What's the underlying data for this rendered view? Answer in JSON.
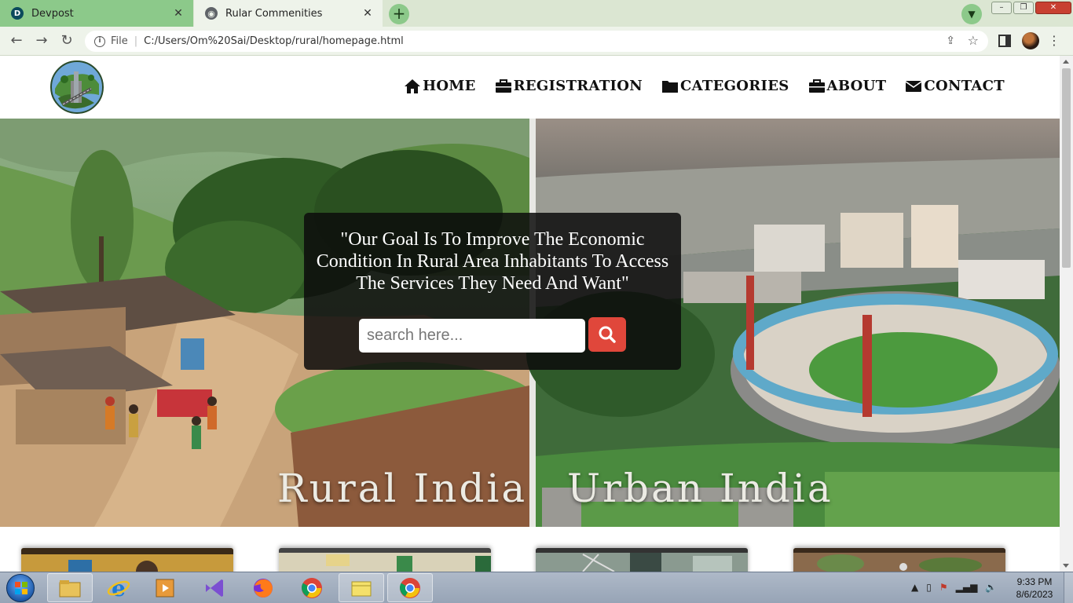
{
  "browser": {
    "tabs": [
      {
        "label": "Devpost",
        "favicon": "D",
        "active": false
      },
      {
        "label": "Rular Commenities",
        "favicon": "🌐",
        "active": true
      }
    ],
    "new_tab_label": "+",
    "url_scheme_label": "File",
    "url": "C:/Users/Om%20Sai/Desktop/rural/homepage.html"
  },
  "site": {
    "nav": [
      {
        "label": "HOME",
        "icon": "home-icon"
      },
      {
        "label": "REGISTRATION",
        "icon": "briefcase-icon"
      },
      {
        "label": "CATEGORIES",
        "icon": "folder-icon"
      },
      {
        "label": "ABOUT",
        "icon": "briefcase-icon"
      },
      {
        "label": "CONTACT",
        "icon": "envelope-icon"
      }
    ],
    "hero": {
      "quote": "\"Our Goal Is To Improve The Economic Condition In Rural Area Inhabitants To Access The Services They Need And Want\"",
      "search_placeholder": "search here...",
      "left_caption": "Rural India",
      "right_caption": "Urban India"
    },
    "colors": {
      "search_button": "#e0473b",
      "overlay": "#0c0c0c"
    }
  },
  "taskbar": {
    "time": "9:33 PM",
    "date": "8/6/2023",
    "apps": [
      "file-explorer-icon",
      "internet-explorer-icon",
      "media-player-icon",
      "visual-studio-icon",
      "firefox-icon",
      "chrome-icon",
      "notes-folder-icon",
      "chrome-icon"
    ]
  }
}
